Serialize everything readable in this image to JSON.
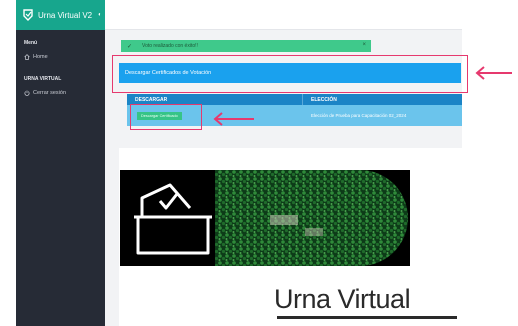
{
  "app": {
    "title": "Urna Virtual V2"
  },
  "sidebar": {
    "section_menu": "Menú",
    "home_label": "Home",
    "section_urna": "URNA VIRTUAL",
    "logout_label": "Cerrar sesión"
  },
  "alert": {
    "message": "Voto realizado con éxito!!",
    "close": "×"
  },
  "actions": {
    "cert_button": "Descargar Certificados de Votación"
  },
  "table": {
    "headers": [
      "DESCARGAR",
      "ELECCIÓN"
    ],
    "rows": [
      {
        "download_label": "Descargar Certificado",
        "election": "Elección de Prueba para Capacitación 02_2024"
      }
    ]
  },
  "banner": {
    "brand_text": "Urna Virtual"
  },
  "colors": {
    "sidebar_bg": "#262b36",
    "brand_bar": "#17a68d",
    "success_alert": "#3fc98b",
    "primary_button": "#1aa1ee",
    "table_header": "#1b84c6",
    "table_row": "#6bc4ec",
    "annotation": "#e6396e"
  },
  "icons": [
    "urna-logo-icon",
    "sidebar-toggle-icon",
    "home-icon",
    "power-icon",
    "check-icon",
    "ballot-box-icon",
    "arrow-left-icon"
  ]
}
